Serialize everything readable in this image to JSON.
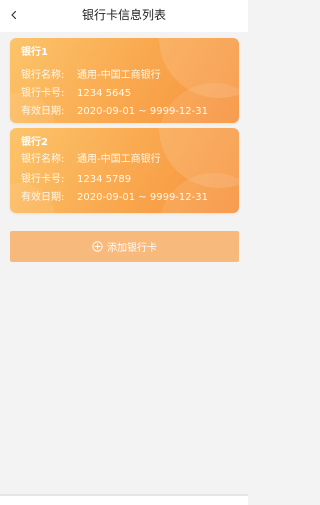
{
  "header": {
    "title": "银行卡信息列表",
    "back_icon": "chevron-left-icon"
  },
  "cards": [
    {
      "title": "银行1",
      "bank_name_label": "银行名称:",
      "bank_name": "通用-中国工商银行",
      "card_no_label": "银行卡号:",
      "card_no": "1234 5645",
      "valid_label": "有效日期:",
      "valid": "2020-09-01 ~ 9999-12-31"
    },
    {
      "title": "银行2",
      "bank_name_label": "银行名称:",
      "bank_name": "通用-中国工商银行",
      "card_no_label": "银行卡号:",
      "card_no": "1234 5789",
      "valid_label": "有效日期:",
      "valid": "2020-09-01 ~ 9999-12-31"
    }
  ],
  "add_button": {
    "label": "添加银行卡",
    "icon": "plus-circle-icon"
  },
  "colors": {
    "card_gradient_start": "#fcc46a",
    "card_gradient_end": "#f6913c",
    "add_button_bg": "#f8b97c",
    "page_bg": "#f3f3f3"
  }
}
